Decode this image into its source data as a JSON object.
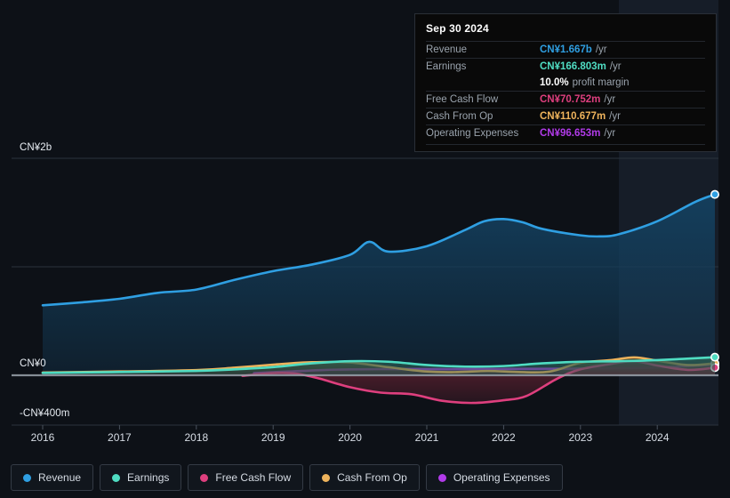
{
  "chart_data": {
    "type": "area",
    "title": "",
    "xlabel": "",
    "ylabel": "",
    "currency": "CN¥",
    "grid": true,
    "legend_position": "bottom",
    "x_ticks": [
      "2016",
      "2017",
      "2018",
      "2019",
      "2020",
      "2021",
      "2022",
      "2023",
      "2024"
    ],
    "y_ticks": [
      "CN¥2b",
      "CN¥0",
      "-CN¥400m"
    ],
    "ylim": [
      -400000000,
      2000000000
    ],
    "xlim": [
      "2016",
      "2024.9"
    ],
    "forecast_start": "2023.5",
    "series": [
      {
        "name": "Revenue",
        "color": "#2f9fe2",
        "fill": "#14405f",
        "x": [
          2016.0,
          2016.5,
          2017.0,
          2017.5,
          2018.0,
          2018.5,
          2019.0,
          2019.5,
          2020.0,
          2020.25,
          2020.5,
          2021.0,
          2021.5,
          2021.75,
          2022.0,
          2022.25,
          2022.5,
          2023.0,
          2023.25,
          2023.5,
          2024.0,
          2024.5,
          2024.75
        ],
        "values": [
          0.645,
          0.672,
          0.705,
          0.76,
          0.79,
          0.88,
          0.96,
          1.02,
          1.11,
          1.23,
          1.14,
          1.19,
          1.34,
          1.42,
          1.44,
          1.41,
          1.35,
          1.29,
          1.28,
          1.3,
          1.42,
          1.6,
          1.667
        ],
        "unit": "CN¥ billions"
      },
      {
        "name": "Earnings",
        "color": "#4fdcc2",
        "fill": "#2b5b52",
        "x": [
          2016.0,
          2017.0,
          2018.0,
          2018.5,
          2019.0,
          2019.5,
          2020.0,
          2020.5,
          2021.0,
          2021.5,
          2022.0,
          2022.5,
          2023.0,
          2023.5,
          2024.0,
          2024.75
        ],
        "values": [
          0.022,
          0.03,
          0.04,
          0.055,
          0.075,
          0.11,
          0.13,
          0.125,
          0.095,
          0.08,
          0.085,
          0.11,
          0.125,
          0.13,
          0.14,
          0.1668
        ],
        "unit": "CN¥ billions"
      },
      {
        "name": "Free Cash Flow",
        "color": "#de3f7e",
        "fill": "#5c2030",
        "x": [
          2018.6,
          2019.0,
          2019.3,
          2019.6,
          2020.0,
          2020.4,
          2020.8,
          2021.2,
          2021.6,
          2022.0,
          2022.3,
          2022.7,
          2023.0,
          2023.4,
          2023.7,
          2024.0,
          2024.4,
          2024.75
        ],
        "values": [
          -0.005,
          0.02,
          0.015,
          -0.03,
          -0.11,
          -0.16,
          -0.175,
          -0.235,
          -0.255,
          -0.23,
          -0.19,
          -0.03,
          0.055,
          0.105,
          0.13,
          0.09,
          0.05,
          0.0708
        ],
        "unit": "CN¥ billions"
      },
      {
        "name": "Cash From Op",
        "color": "#eeb35c",
        "fill": "#5a4624",
        "x": [
          2016.0,
          2017.0,
          2018.0,
          2018.5,
          2019.0,
          2019.5,
          2020.0,
          2020.5,
          2021.0,
          2021.4,
          2021.8,
          2022.2,
          2022.6,
          2023.0,
          2023.4,
          2023.7,
          2024.0,
          2024.4,
          2024.75
        ],
        "values": [
          0.025,
          0.035,
          0.048,
          0.07,
          0.098,
          0.12,
          0.118,
          0.075,
          0.035,
          0.03,
          0.04,
          0.03,
          0.035,
          0.115,
          0.14,
          0.165,
          0.135,
          0.095,
          0.1107
        ],
        "unit": "CN¥ billions"
      },
      {
        "name": "Operating Expenses",
        "color": "#b13be9",
        "fill": "#4a2560",
        "x": [
          2018.75,
          2019.2,
          2019.6,
          2020.0,
          2020.6,
          2021.2,
          2021.8,
          2022.4,
          2023.0,
          2023.6,
          2024.0,
          2024.75
        ],
        "values": [
          0.02,
          0.035,
          0.048,
          0.055,
          0.058,
          0.057,
          0.058,
          0.06,
          0.062,
          0.066,
          0.072,
          0.0967
        ],
        "unit": "CN¥ billions"
      }
    ]
  },
  "tooltip": {
    "date": "Sep 30 2024",
    "rows": [
      {
        "label": "Revenue",
        "value": "CN¥1.667b",
        "suffix": "/yr",
        "color": "#2f9fe2"
      },
      {
        "label": "Earnings",
        "value": "CN¥166.803m",
        "suffix": "/yr",
        "color": "#4fdcc2"
      },
      {
        "label": "",
        "value": "10.0%",
        "suffix": "profit margin",
        "color": "#ffffff",
        "margin_row": true
      },
      {
        "label": "Free Cash Flow",
        "value": "CN¥70.752m",
        "suffix": "/yr",
        "color": "#de3f7e"
      },
      {
        "label": "Cash From Op",
        "value": "CN¥110.677m",
        "suffix": "/yr",
        "color": "#eeb35c"
      },
      {
        "label": "Operating Expenses",
        "value": "CN¥96.653m",
        "suffix": "/yr",
        "color": "#b13be9"
      }
    ]
  },
  "legend": {
    "items": [
      {
        "label": "Revenue",
        "color": "#2f9fe2"
      },
      {
        "label": "Earnings",
        "color": "#4fdcc2"
      },
      {
        "label": "Free Cash Flow",
        "color": "#de3f7e"
      },
      {
        "label": "Cash From Op",
        "color": "#eeb35c"
      },
      {
        "label": "Operating Expenses",
        "color": "#b13be9"
      }
    ]
  },
  "axes": {
    "y_top_label": "CN¥2b",
    "y_zero_label": "CN¥0",
    "y_bottom_label": "-CN¥400m",
    "x_labels": [
      "2016",
      "2017",
      "2018",
      "2019",
      "2020",
      "2021",
      "2022",
      "2023",
      "2024"
    ]
  },
  "colors": {
    "background": "#0d1117",
    "forecast_background": "#161d28",
    "gridline": "#2b323c",
    "zero_line": "#9aa3ad"
  }
}
